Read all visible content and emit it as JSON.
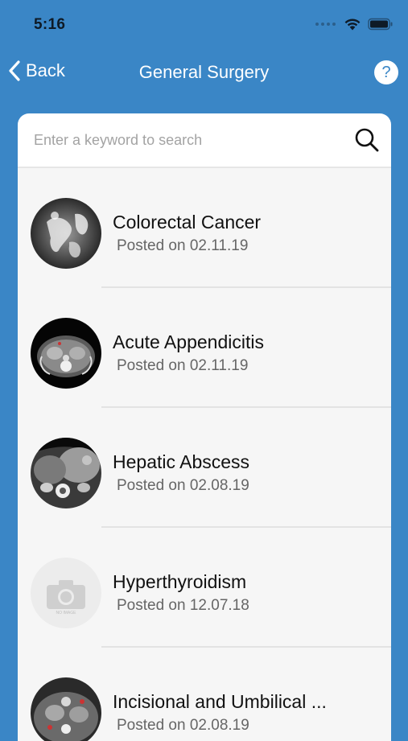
{
  "status_bar": {
    "time": "5:16"
  },
  "nav": {
    "back_label": "Back",
    "title": "General Surgery",
    "help_label": "?"
  },
  "search": {
    "placeholder": "Enter a keyword to search",
    "value": ""
  },
  "cases": [
    {
      "title": "Colorectal Cancer",
      "date": "Posted on 02.11.19",
      "image": "ct-abdomen-barium"
    },
    {
      "title": "Acute Appendicitis",
      "date": "Posted on 02.11.19",
      "image": "ct-axial-abdomen"
    },
    {
      "title": "Hepatic Abscess",
      "date": "Posted on 02.08.19",
      "image": "ct-liver"
    },
    {
      "title": "Hyperthyroidism",
      "date": "Posted on 12.07.18",
      "image": "no-image-placeholder",
      "no_image_text": "NO IMAGE"
    },
    {
      "title": "Incisional and Umbilical ...",
      "date": "Posted on 02.08.19",
      "image": "ct-abdomen-wall"
    }
  ],
  "colors": {
    "background": "#3a86c6",
    "card": "#ffffff",
    "list_background": "#f6f6f6"
  }
}
